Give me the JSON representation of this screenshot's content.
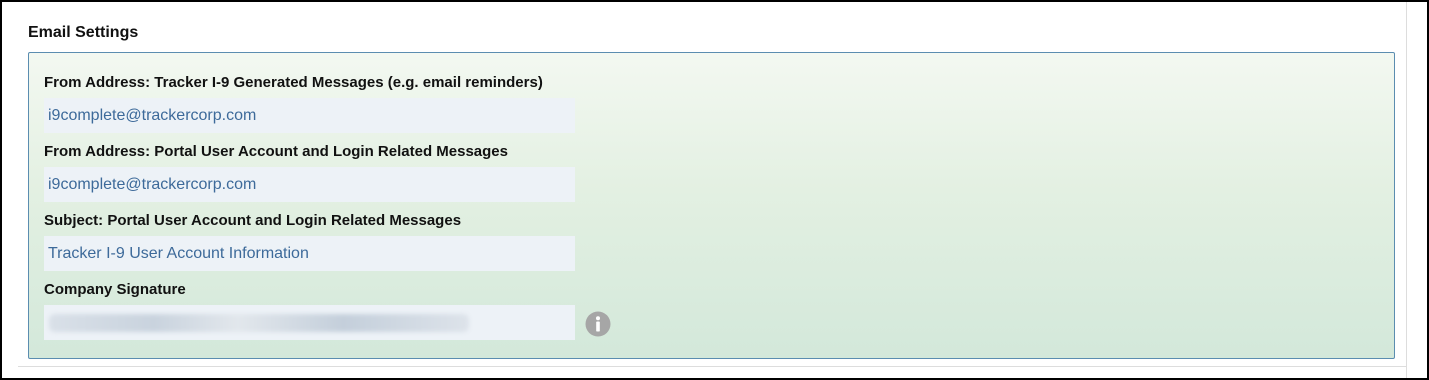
{
  "section": {
    "title": "Email Settings"
  },
  "fields": {
    "from_tracker": {
      "label": "From Address: Tracker I-9 Generated Messages (e.g. email reminders)",
      "value": "i9complete@trackercorp.com"
    },
    "from_portal": {
      "label": "From Address: Portal User Account and Login Related Messages",
      "value": "i9complete@trackercorp.com"
    },
    "subject_portal": {
      "label": "Subject: Portal User Account and Login Related Messages",
      "value": "Tracker I-9 User Account Information"
    },
    "signature": {
      "label": "Company Signature",
      "value": ""
    }
  },
  "icons": {
    "info": "info-icon"
  },
  "colors": {
    "panel_border": "#5b8db0",
    "input_text": "#3d6a9a",
    "input_background": "#edf2f7",
    "info_icon": "#a6a6a6"
  }
}
